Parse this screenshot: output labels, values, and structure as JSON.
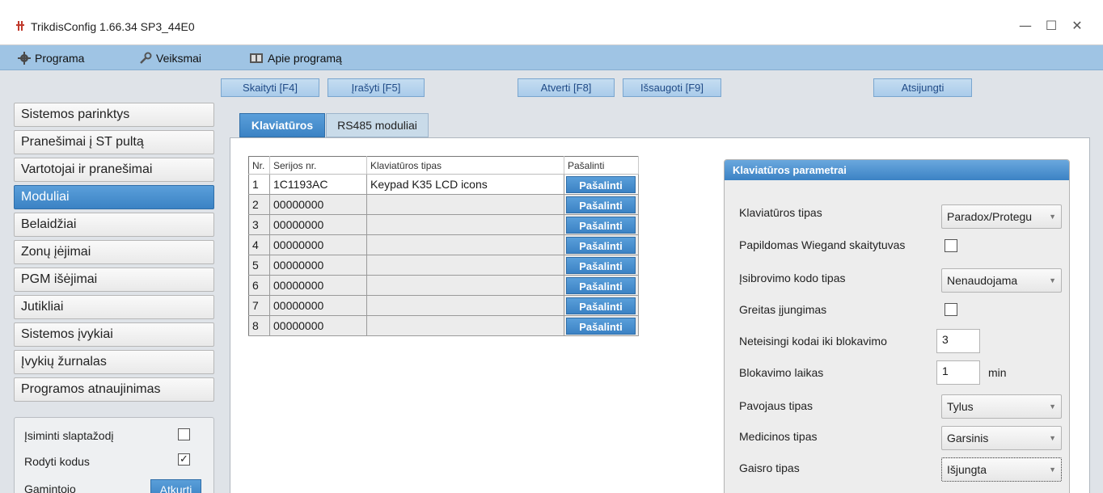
{
  "window": {
    "title": "TrikdisConfig 1.66.34   SP3_44E0",
    "controls": {
      "minimize": "—",
      "maximize": "☐",
      "close": "✕"
    }
  },
  "menu": [
    {
      "label": "Programa",
      "icon": "gear-icon"
    },
    {
      "label": "Veiksmai",
      "icon": "wrench-icon"
    },
    {
      "label": "Apie programą",
      "icon": "book-icon"
    }
  ],
  "toolbar": {
    "read": "Skaityti [F4]",
    "write": "Įrašyti [F5]",
    "open": "Atverti [F8]",
    "save": "Išsaugoti [F9]",
    "disconnect": "Atsijungti"
  },
  "sidebar": {
    "items": [
      "Sistemos parinktys",
      "Pranešimai į ST pultą",
      "Vartotojai ir pranešimai",
      "Moduliai",
      "Belaidžiai",
      "Zonų įėjimai",
      "PGM išėjimai",
      "Jutikliai",
      "Sistemos įvykiai",
      "Įvykių žurnalas",
      "Programos atnaujinimas"
    ],
    "active_index": 3
  },
  "options": {
    "remember_password": {
      "label": "Įsiminti slaptažodį",
      "checked": false
    },
    "show_codes": {
      "label": "Rodyti kodus",
      "checked": true
    },
    "factory": {
      "label": "Gamintojo",
      "button": "Atkurti"
    }
  },
  "tabs": [
    {
      "label": "Klaviatūros",
      "active": true
    },
    {
      "label": "RS485 moduliai",
      "active": false
    }
  ],
  "keypad_table": {
    "headers": [
      "Nr.",
      "Serijos nr.",
      "Klaviatūros tipas",
      "Pašalinti"
    ],
    "delete_label": "Pašalinti",
    "rows": [
      {
        "nr": "1",
        "serial": "1C1193AC",
        "type": "Keypad K35 LCD icons"
      },
      {
        "nr": "2",
        "serial": "00000000",
        "type": ""
      },
      {
        "nr": "3",
        "serial": "00000000",
        "type": ""
      },
      {
        "nr": "4",
        "serial": "00000000",
        "type": ""
      },
      {
        "nr": "5",
        "serial": "00000000",
        "type": ""
      },
      {
        "nr": "6",
        "serial": "00000000",
        "type": ""
      },
      {
        "nr": "7",
        "serial": "00000000",
        "type": ""
      },
      {
        "nr": "8",
        "serial": "00000000",
        "type": ""
      }
    ]
  },
  "params": {
    "title": "Klaviatūros parametrai",
    "keypad_type": {
      "label": "Klaviatūros tipas",
      "value": "Paradox/Protegu"
    },
    "wiegand": {
      "label": "Papildomas Wiegand skaitytuvas",
      "checked": false
    },
    "duress_code": {
      "label": "Įsibrovimo kodo tipas",
      "value": "Nenaudojama"
    },
    "quick_arm": {
      "label": "Greitas įjungimas",
      "checked": false
    },
    "wrong_codes": {
      "label": "Neteisingi kodai iki blokavimo",
      "value": "3"
    },
    "block_time": {
      "label": "Blokavimo laikas",
      "value": "1",
      "unit": "min"
    },
    "panic_type": {
      "label": "Pavojaus tipas",
      "value": "Tylus"
    },
    "medical_type": {
      "label": "Medicinos tipas",
      "value": "Garsinis"
    },
    "fire_type": {
      "label": "Gaisro tipas",
      "value": "Išjungta"
    }
  },
  "colors": {
    "accent": "#3b82c4",
    "menubar": "#9fc4e4",
    "toolbar_text": "#1f4a86"
  }
}
